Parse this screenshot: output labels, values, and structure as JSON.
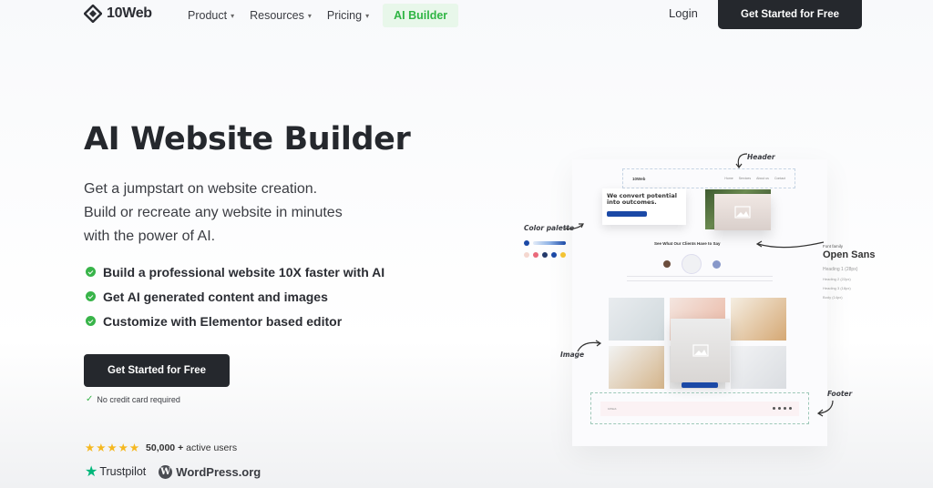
{
  "nav": {
    "logo_text": "10Web",
    "links": [
      {
        "label": "Product",
        "has_dropdown": true
      },
      {
        "label": "Resources",
        "has_dropdown": true
      },
      {
        "label": "Pricing",
        "has_dropdown": true
      }
    ],
    "highlight_link": "AI Builder",
    "login_label": "Login",
    "cta_label": "Get Started for Free"
  },
  "hero": {
    "title": "AI Website Builder",
    "subtitle_lines": [
      "Get a jumpstart on website creation.",
      "Build or recreate any website in minutes",
      "with the power of AI."
    ],
    "features": [
      "Build a professional website 10X faster with AI",
      "Get AI generated content and images",
      "Customize with Elementor based editor"
    ],
    "cta_label": "Get Started for Free",
    "no_credit_card": "No credit card required",
    "rating": {
      "stars": 5,
      "stars_glyph": "★★★★★",
      "count": "50,000 +",
      "label": "active users"
    },
    "badges": {
      "trustpilot": "Trustpilot",
      "wordpress": "WordPress.org"
    }
  },
  "mockup": {
    "annotations": {
      "header": "Header",
      "color_palette": "Color palette",
      "image": "Image",
      "footer": "Footer"
    },
    "font": {
      "label": "Font family",
      "name": "Open Sans",
      "samples": [
        "Heading 1 (28px)",
        "Heading 2 (22px)",
        "Heading 3 (18px)",
        "Body (14px)"
      ]
    },
    "hero_card_title": "We convert potential into outcomes.",
    "site_brand": "10Web",
    "site_menu": [
      "Home",
      "Services",
      "About us",
      "Contact"
    ],
    "testimonials_title": "See What Our Clients Have to Say",
    "palette_colors": [
      "#f4d7cf",
      "#e9697a",
      "#233a6b",
      "#1b49a6",
      "#f3c333"
    ],
    "accent_color": "#1b49a6"
  },
  "colors": {
    "dark": "#25282d",
    "green": "#38b449",
    "ai_builder_bg": "#e8f7ea",
    "ai_builder_text": "#2fb544",
    "star": "#f5b820",
    "trustpilot": "#00b67a"
  }
}
